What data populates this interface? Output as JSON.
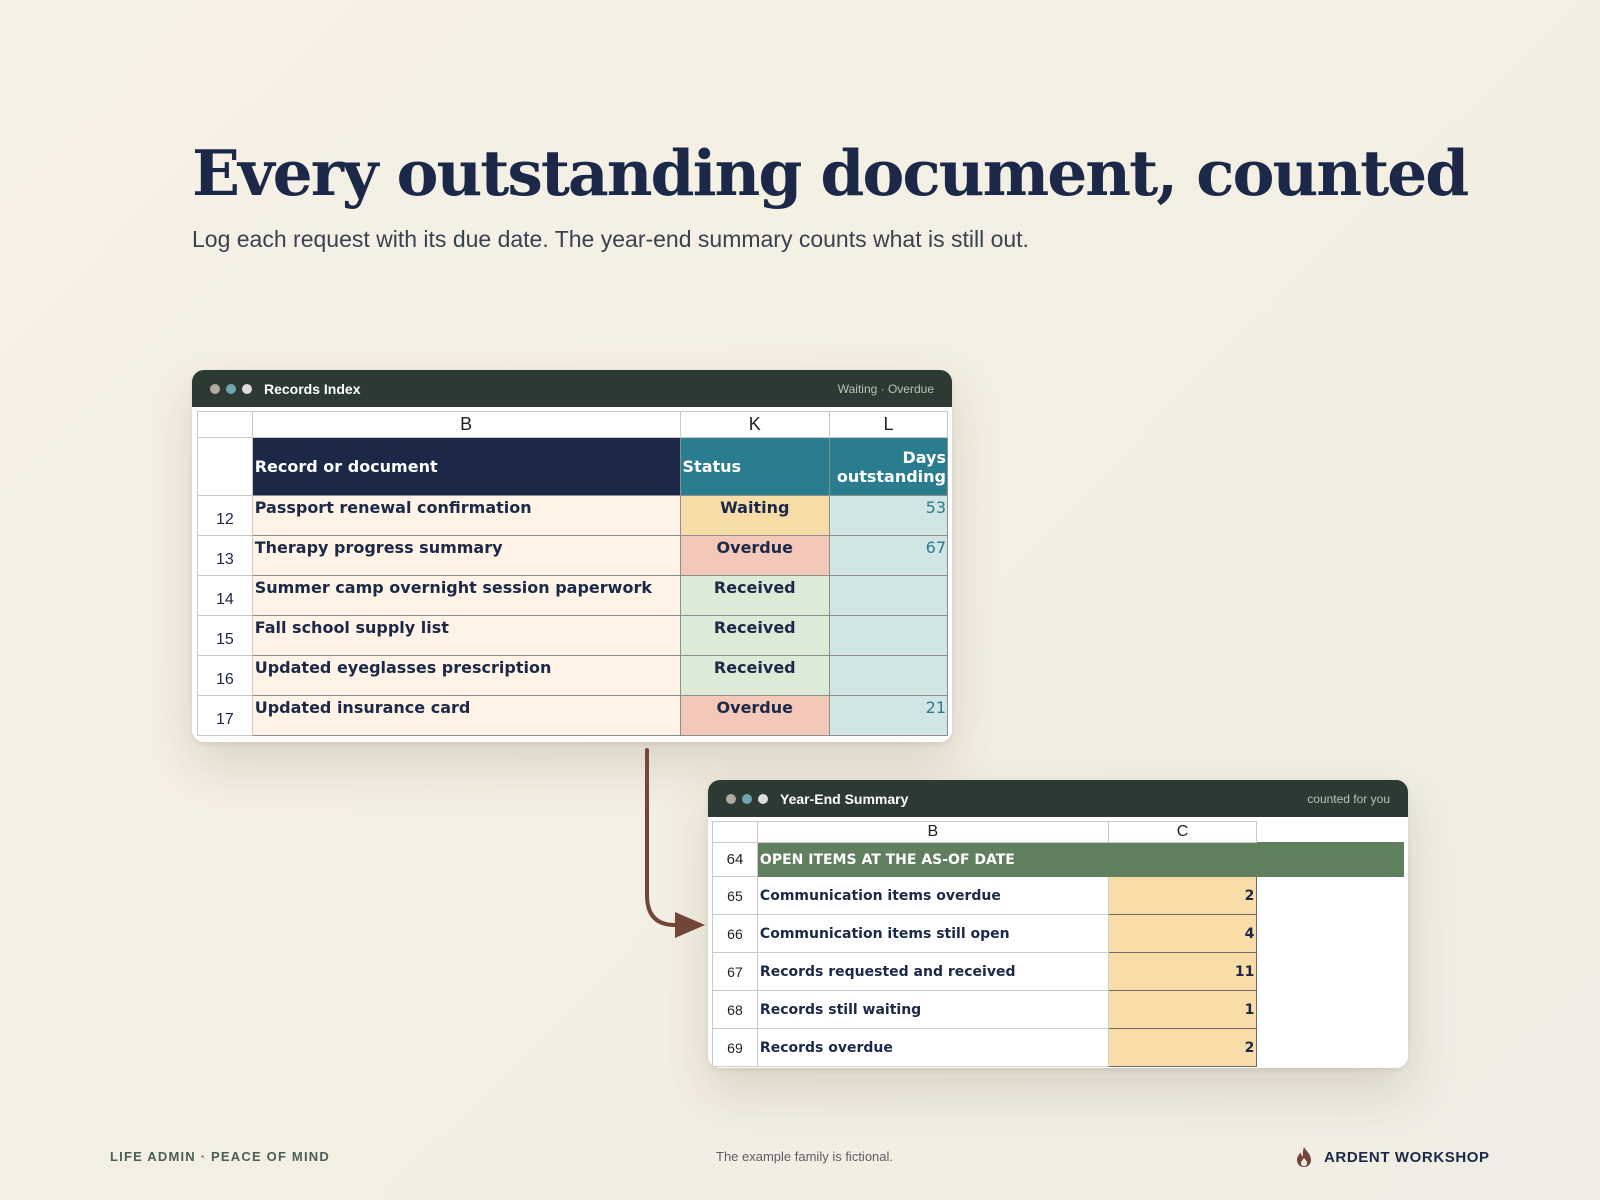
{
  "headline": "Every outstanding document, counted",
  "subhead": "Log each request with its due date. The year-end summary counts what is still out.",
  "colors": {
    "navy": "#1b2848",
    "teal": "#2a7d8f",
    "waiting": "#f8dca8",
    "overdue": "#f3c8b8",
    "received": "#dcebd8",
    "summary_green": "#5f7f5f",
    "arrow": "#74463a"
  },
  "records_window": {
    "title": "Records Index",
    "tag": "Waiting · Overdue",
    "dot_colors": [
      "#b4aa9e",
      "#6fa6b2",
      "#dcdcdc"
    ],
    "columns": [
      "B",
      "K",
      "L"
    ],
    "header_row": "2",
    "headers": {
      "document": "Record or document",
      "status": "Status",
      "days": "Days outstanding"
    },
    "rows": [
      {
        "row": "12",
        "document": "Passport renewal confirmation",
        "status": "Waiting",
        "days": "53"
      },
      {
        "row": "13",
        "document": "Therapy progress summary",
        "status": "Overdue",
        "days": "67"
      },
      {
        "row": "14",
        "document": "Summer camp overnight session paperwork",
        "status": "Received",
        "days": ""
      },
      {
        "row": "15",
        "document": "Fall school supply list",
        "status": "Received",
        "days": ""
      },
      {
        "row": "16",
        "document": "Updated eyeglasses prescription",
        "status": "Received",
        "days": ""
      },
      {
        "row": "17",
        "document": "Updated insurance card",
        "status": "Overdue",
        "days": "21"
      }
    ]
  },
  "summary_window": {
    "title": "Year-End Summary",
    "tag": "counted for you",
    "dot_colors": [
      "#b4aa9e",
      "#6fa6b2",
      "#dcdcdc"
    ],
    "columns": [
      "B",
      "C"
    ],
    "section_row": "64",
    "section_label": "OPEN ITEMS AT THE AS-OF DATE",
    "rows": [
      {
        "row": "65",
        "label": "Communication items overdue",
        "value": "2"
      },
      {
        "row": "66",
        "label": "Communication items still open",
        "value": "4"
      },
      {
        "row": "67",
        "label": "Records requested and received",
        "value": "11"
      },
      {
        "row": "68",
        "label": "Records still waiting",
        "value": "1"
      },
      {
        "row": "69",
        "label": "Records overdue",
        "value": "2"
      }
    ]
  },
  "footer": {
    "left": "LIFE ADMIN · PEACE OF MIND",
    "middle": "The example family is fictional.",
    "brand": "ARDENT WORKSHOP",
    "brand_icon": "flame-icon"
  }
}
